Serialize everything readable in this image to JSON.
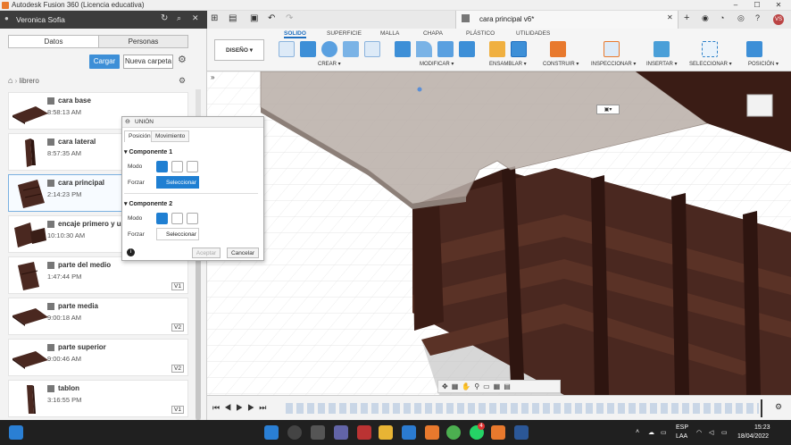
{
  "window": {
    "title": "Autodesk Fusion 360 (Licencia educativa)"
  },
  "panel": {
    "user": "Veronica Sofia",
    "tabs": [
      "Datos",
      "Personas"
    ],
    "upload_button": "Cargar",
    "new_folder_button": "Nueva carpeta",
    "breadcrumb": "librero",
    "files": [
      {
        "name": "cara base",
        "time": "8:58:13 AM",
        "version": ""
      },
      {
        "name": "cara lateral",
        "time": "8:57:35 AM",
        "version": ""
      },
      {
        "name": "cara principal",
        "time": "2:14:23 PM",
        "version": ""
      },
      {
        "name": "encaje primero y ulti",
        "time": "10:10:30 AM",
        "version": ""
      },
      {
        "name": "parte del medio",
        "time": "1:47:44 PM",
        "version": "V1"
      },
      {
        "name": "parte media",
        "time": "9:00:18 AM",
        "version": "V2"
      },
      {
        "name": "parte superior",
        "time": "9:00:46 AM",
        "version": "V2"
      },
      {
        "name": "tablon",
        "time": "3:16:55 PM",
        "version": "V1"
      }
    ]
  },
  "document": {
    "tab_name": "cara principal v6*"
  },
  "ribbon": {
    "workspace": "DISEÑO",
    "tabs": [
      "SOLIDO",
      "SUPERFICIE",
      "MALLA",
      "CHAPA",
      "PLÁSTICO",
      "UTILIDADES"
    ],
    "groups": [
      "CREAR",
      "MODIFICAR",
      "ENSAMBLAR",
      "CONSTRUIR",
      "INSPECCIONAR",
      "INSERTAR",
      "SELECCIONAR",
      "POSICIÓN"
    ]
  },
  "dialog": {
    "title": "UNIÓN",
    "tabs": [
      "Posición",
      "Movimiento"
    ],
    "section1": "Componente 1",
    "section2": "Componente 2",
    "mode_label": "Modo",
    "snap_label": "Forzar",
    "select_label": "Seleccionar",
    "ok": "Aceptar",
    "cancel": "Cancelar"
  },
  "taskbar": {
    "lang": "ESP",
    "lang2": "LAA",
    "time": "15:23",
    "date": "18/04/2022",
    "badge": "4"
  },
  "colors": {
    "accent": "#3d8fd7",
    "wood": "#4a2820",
    "taskbar": "#202020"
  }
}
